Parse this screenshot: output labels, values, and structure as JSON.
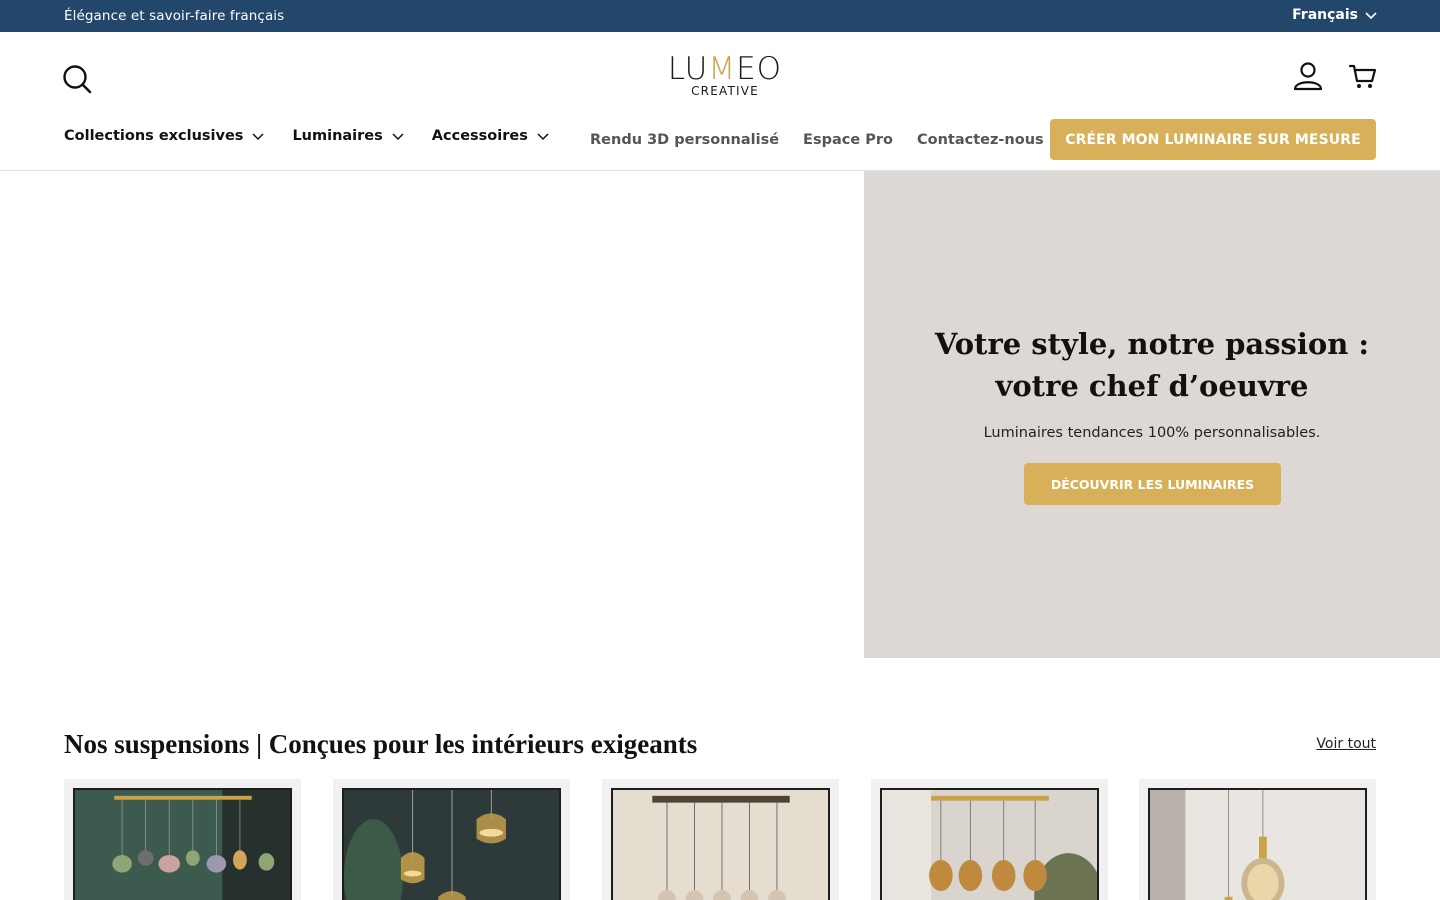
{
  "announcement": {
    "tagline": "Élégance et savoir-faire français",
    "language": "Français"
  },
  "brand": {
    "logo_main_before": "LU",
    "logo_main_accent": "M",
    "logo_main_after": "EO",
    "logo_sub": "CREATIVE",
    "accent_color": "#c9a24a",
    "primary_color": "#23476b",
    "cta_color": "#d9b05a"
  },
  "header": {
    "icons": [
      "search-icon",
      "account-icon",
      "cart-icon"
    ]
  },
  "nav": {
    "primary": [
      {
        "label": "Collections exclusives"
      },
      {
        "label": "Luminaires"
      },
      {
        "label": "Accessoires"
      }
    ],
    "secondary": [
      {
        "label": "Rendu 3D personnalisé"
      },
      {
        "label": "Espace Pro"
      },
      {
        "label": "Contactez-nous"
      }
    ],
    "cta": "CRÉER MON LUMINAIRE SUR MESURE"
  },
  "hero": {
    "title": "Votre style, notre passion : votre chef d’oeuvre",
    "subtitle": "Luminaires tendances 100% personnalisables.",
    "button": "DÉCOUVRIR LES LUMINAIRES",
    "panel_color": "#ddd8d3"
  },
  "collection": {
    "title": "Nos suspensions | Conçues pour les intérieurs exigeants",
    "see_all": "Voir tout"
  }
}
